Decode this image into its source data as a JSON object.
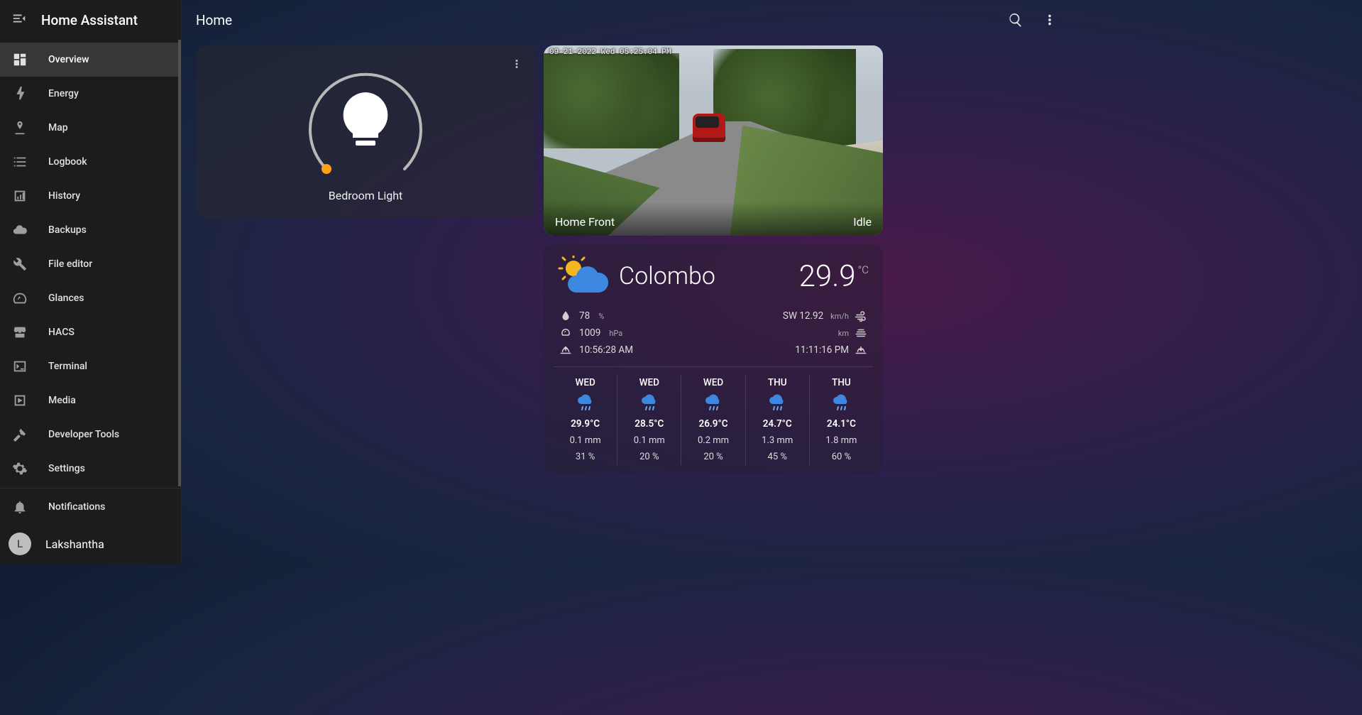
{
  "app_title": "Home Assistant",
  "page_title": "Home",
  "sidebar": {
    "items": [
      {
        "label": "Overview",
        "icon": "dashboard-icon",
        "active": true
      },
      {
        "label": "Energy",
        "icon": "bolt-icon"
      },
      {
        "label": "Map",
        "icon": "map-marker-icon"
      },
      {
        "label": "Logbook",
        "icon": "list-icon"
      },
      {
        "label": "History",
        "icon": "chart-bar-icon"
      },
      {
        "label": "Backups",
        "icon": "cloud-icon"
      },
      {
        "label": "File editor",
        "icon": "wrench-icon"
      },
      {
        "label": "Glances",
        "icon": "gauge-icon"
      },
      {
        "label": "HACS",
        "icon": "store-icon"
      },
      {
        "label": "Terminal",
        "icon": "console-icon"
      },
      {
        "label": "Media",
        "icon": "play-box-icon"
      },
      {
        "label": "Developer Tools",
        "icon": "hammer-icon"
      },
      {
        "label": "Settings",
        "icon": "gear-icon"
      }
    ],
    "notifications_label": "Notifications",
    "user": {
      "name": "Lakshantha",
      "initial": "L"
    }
  },
  "light_card": {
    "name": "Bedroom Light",
    "state": "off"
  },
  "camera_card": {
    "name": "Home Front",
    "status": "Idle",
    "timestamp": "09-21-2022 Wed 05:25:04 PM"
  },
  "weather": {
    "location": "Colombo",
    "temp": "29.9",
    "temp_unit": "°C",
    "humidity": "78",
    "humidity_unit": "%",
    "pressure": "1009",
    "pressure_unit": "hPa",
    "sunrise": "10:56:28 AM",
    "wind": "SW 12.92",
    "wind_unit": "km/h",
    "visibility_unit": "km",
    "sunset": "11:11:16 PM",
    "forecast": [
      {
        "day": "WED",
        "temp": "29.9°C",
        "precip": "0.1 mm",
        "humidity": "31 %"
      },
      {
        "day": "WED",
        "temp": "28.5°C",
        "precip": "0.1 mm",
        "humidity": "20 %"
      },
      {
        "day": "WED",
        "temp": "26.9°C",
        "precip": "0.2 mm",
        "humidity": "20 %"
      },
      {
        "day": "THU",
        "temp": "24.7°C",
        "precip": "1.3 mm",
        "humidity": "45 %"
      },
      {
        "day": "THU",
        "temp": "24.1°C",
        "precip": "1.8 mm",
        "humidity": "60 %"
      }
    ]
  }
}
